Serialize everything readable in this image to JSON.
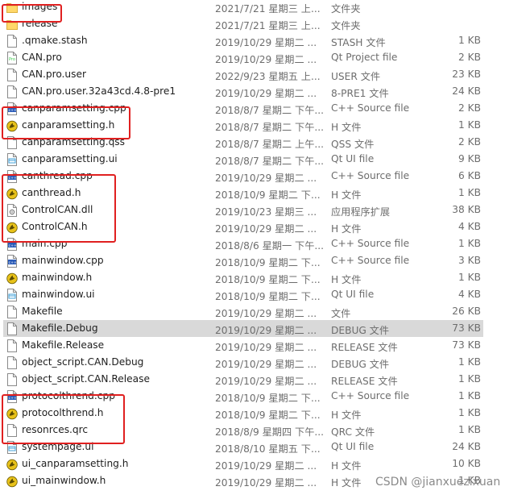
{
  "files": [
    {
      "name": "images",
      "date": "2021/7/21 星期三 上...",
      "type": "文件夹",
      "size": "",
      "icon": "folder-icon"
    },
    {
      "name": "release",
      "date": "2021/7/21 星期三 上...",
      "type": "文件夹",
      "size": "",
      "icon": "folder-icon"
    },
    {
      "name": ".qmake.stash",
      "date": "2019/10/29 星期二 ...",
      "type": "STASH 文件",
      "size": "1 KB",
      "icon": "file-icon"
    },
    {
      "name": "CAN.pro",
      "date": "2019/10/29 星期二 ...",
      "type": "Qt Project file",
      "size": "2 KB",
      "icon": "qt-project-icon"
    },
    {
      "name": "CAN.pro.user",
      "date": "2022/9/23 星期五 上...",
      "type": "USER 文件",
      "size": "23 KB",
      "icon": "file-icon"
    },
    {
      "name": "CAN.pro.user.32a43cd.4.8-pre1",
      "date": "2019/10/29 星期二 ...",
      "type": "8-PRE1 文件",
      "size": "24 KB",
      "icon": "file-icon"
    },
    {
      "name": "canparamsetting.cpp",
      "date": "2018/8/7 星期二 下午...",
      "type": "C++ Source file",
      "size": "2 KB",
      "icon": "cpp-file-icon"
    },
    {
      "name": "canparamsetting.h",
      "date": "2018/8/7 星期二 下午...",
      "type": "H 文件",
      "size": "1 KB",
      "icon": "header-file-icon"
    },
    {
      "name": "canparamsetting.qss",
      "date": "2018/8/7 星期二 上午...",
      "type": "QSS 文件",
      "size": "2 KB",
      "icon": "file-icon"
    },
    {
      "name": "canparamsetting.ui",
      "date": "2018/8/7 星期二 下午...",
      "type": "Qt UI file",
      "size": "9 KB",
      "icon": "ui-file-icon"
    },
    {
      "name": "canthread.cpp",
      "date": "2019/10/29 星期二 ...",
      "type": "C++ Source file",
      "size": "6 KB",
      "icon": "cpp-file-icon"
    },
    {
      "name": "canthread.h",
      "date": "2018/10/9 星期二 下...",
      "type": "H 文件",
      "size": "1 KB",
      "icon": "header-file-icon"
    },
    {
      "name": "ControlCAN.dll",
      "date": "2019/10/23 星期三 ...",
      "type": "应用程序扩展",
      "size": "38 KB",
      "icon": "dll-file-icon"
    },
    {
      "name": "ControlCAN.h",
      "date": "2019/10/29 星期二 ...",
      "type": "H 文件",
      "size": "4 KB",
      "icon": "header-file-icon"
    },
    {
      "name": "main.cpp",
      "date": "2018/8/6 星期一 下午...",
      "type": "C++ Source file",
      "size": "1 KB",
      "icon": "cpp-file-icon"
    },
    {
      "name": "mainwindow.cpp",
      "date": "2018/10/9 星期二 下...",
      "type": "C++ Source file",
      "size": "3 KB",
      "icon": "cpp-file-icon"
    },
    {
      "name": "mainwindow.h",
      "date": "2018/10/9 星期二 下...",
      "type": "H 文件",
      "size": "1 KB",
      "icon": "header-file-icon"
    },
    {
      "name": "mainwindow.ui",
      "date": "2018/10/9 星期二 下...",
      "type": "Qt UI file",
      "size": "4 KB",
      "icon": "ui-file-icon"
    },
    {
      "name": "Makefile",
      "date": "2019/10/29 星期二 ...",
      "type": "文件",
      "size": "26 KB",
      "icon": "file-icon"
    },
    {
      "name": "Makefile.Debug",
      "date": "2019/10/29 星期二 ...",
      "type": "DEBUG 文件",
      "size": "73 KB",
      "icon": "file-icon",
      "selected": true
    },
    {
      "name": "Makefile.Release",
      "date": "2019/10/29 星期二 ...",
      "type": "RELEASE 文件",
      "size": "73 KB",
      "icon": "file-icon"
    },
    {
      "name": "object_script.CAN.Debug",
      "date": "2019/10/29 星期二 ...",
      "type": "DEBUG 文件",
      "size": "1 KB",
      "icon": "file-icon"
    },
    {
      "name": "object_script.CAN.Release",
      "date": "2019/10/29 星期二 ...",
      "type": "RELEASE 文件",
      "size": "1 KB",
      "icon": "file-icon"
    },
    {
      "name": "protocolthrend.cpp",
      "date": "2018/10/9 星期二 下...",
      "type": "C++ Source file",
      "size": "1 KB",
      "icon": "cpp-file-icon"
    },
    {
      "name": "protocolthrend.h",
      "date": "2018/10/9 星期二 下...",
      "type": "H 文件",
      "size": "1 KB",
      "icon": "header-file-icon"
    },
    {
      "name": "resonrces.qrc",
      "date": "2018/8/9 星期四 下午...",
      "type": "QRC 文件",
      "size": "1 KB",
      "icon": "file-icon"
    },
    {
      "name": "systempage.ui",
      "date": "2018/8/10 星期五 下...",
      "type": "Qt UI file",
      "size": "24 KB",
      "icon": "ui-file-icon"
    },
    {
      "name": "ui_canparamsetting.h",
      "date": "2019/10/29 星期二 ...",
      "type": "H 文件",
      "size": "10 KB",
      "icon": "header-file-icon"
    },
    {
      "name": "ui_mainwindow.h",
      "date": "2019/10/29 星期二 ...",
      "type": "H 文件",
      "size": "1 KB",
      "icon": "header-file-icon"
    }
  ],
  "highlight_color": "#e02020",
  "watermark": "CSDN @jianxuezixuan"
}
